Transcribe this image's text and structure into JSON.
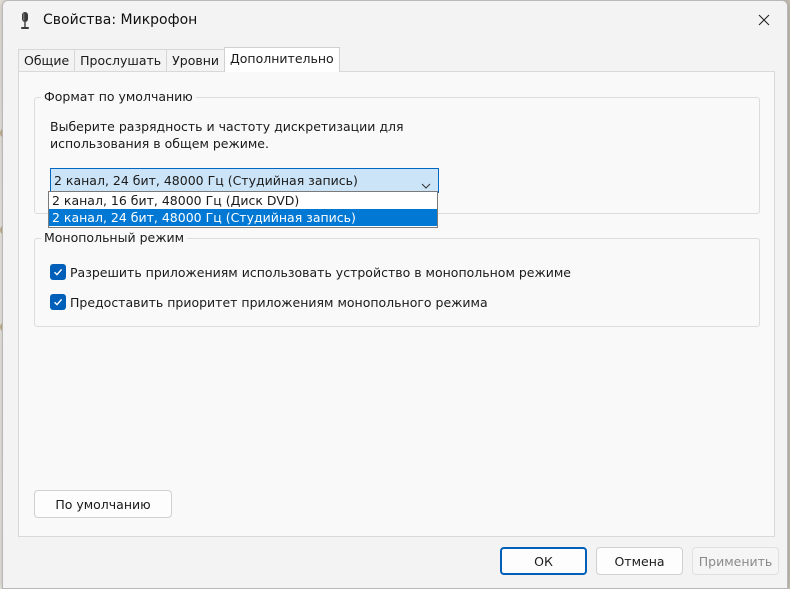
{
  "window": {
    "title": "Свойства: Микрофон",
    "close_icon": "close-icon"
  },
  "tabs": [
    {
      "label": "Общие",
      "active": false
    },
    {
      "label": "Прослушать",
      "active": false
    },
    {
      "label": "Уровни",
      "active": false
    },
    {
      "label": "Дополнительно",
      "active": true
    }
  ],
  "default_format": {
    "legend": "Формат по умолчанию",
    "description": "Выберите разрядность и частоту дискретизации для использования в общем режиме.",
    "selected_value": "2 канал, 24 бит, 48000 Гц (Студийная запись)",
    "options": [
      {
        "label": "2 канал, 16 бит, 48000 Гц (Диск DVD)",
        "selected": false
      },
      {
        "label": "2 канал, 24 бит, 48000 Гц (Студийная запись)",
        "selected": true
      }
    ]
  },
  "exclusive_mode": {
    "legend": "Монопольный режим",
    "checkboxes": [
      {
        "label": "Разрешить приложениям использовать устройство в монопольном режиме",
        "checked": true
      },
      {
        "label": "Предоставить приоритет приложениям монопольного режима",
        "checked": true
      }
    ]
  },
  "buttons": {
    "restore_defaults": "По умолчанию",
    "ok": "ОК",
    "cancel": "Отмена",
    "apply": "Применить"
  },
  "colors": {
    "accent": "#005fb8",
    "selection": "#0078d4",
    "select_bg": "#cce4f7"
  }
}
